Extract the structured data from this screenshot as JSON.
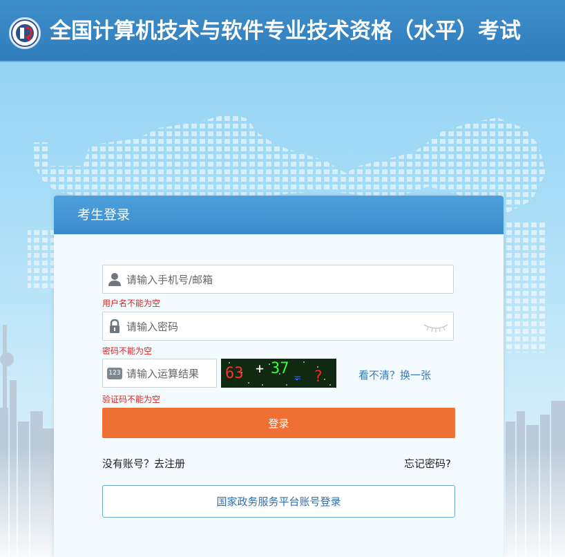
{
  "header": {
    "title": "全国计算机技术与软件专业技术资格（水平）考试"
  },
  "login": {
    "title": "考生登录",
    "username": {
      "placeholder": "请输入手机号/邮箱",
      "error": "用户名不能为空"
    },
    "password": {
      "placeholder": "请输入密码",
      "error": "密码不能为空"
    },
    "captcha": {
      "badge": "123",
      "placeholder": "请输入运算结果",
      "error": "验证码不能为空",
      "image_text": [
        "63",
        "+",
        "37",
        "=",
        "?"
      ],
      "refresh_label": "看不清？换一张"
    },
    "submit_label": "登录",
    "register_label": "没有账号？去注册",
    "forgot_label": "忘记密码?",
    "gov_login_label": "国家政务服务平台账号登录"
  },
  "colors": {
    "header_bg": "#3a8ac7",
    "primary_button": "#f07033",
    "link": "#3a78b8",
    "error": "#e02020"
  },
  "icons": [
    "logo-emblem",
    "user-icon",
    "lock-icon",
    "eye-closed-icon",
    "captcha-badge"
  ]
}
